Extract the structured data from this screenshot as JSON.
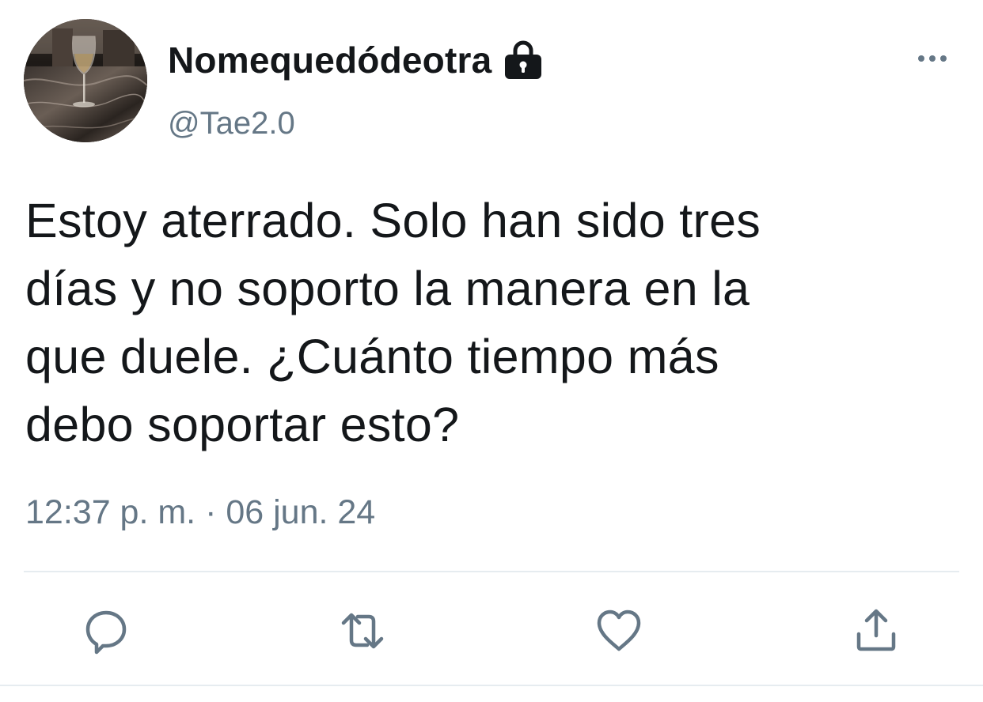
{
  "user": {
    "display_name": "Nomequedódeotra",
    "handle": "@Tae2.0",
    "protected_icon": "lock-icon",
    "avatar": "wine-glass-photo"
  },
  "tweet": {
    "text_lines": [
      "Estoy aterrado. Solo han sido tres",
      "días y no soporto la manera en la",
      "que duele. ¿Cuánto tiempo más",
      "debo soportar esto?"
    ],
    "timestamp": "12:37 p. m. · 06 jun. 24"
  },
  "actions": {
    "reply_icon": "reply-icon",
    "retweet_icon": "retweet-icon",
    "like_icon": "heart-icon",
    "share_icon": "share-icon",
    "more_icon": "more-options-icon"
  },
  "colors": {
    "text": "#14171a",
    "secondary": "#657786",
    "divider": "#e6ecf0"
  }
}
